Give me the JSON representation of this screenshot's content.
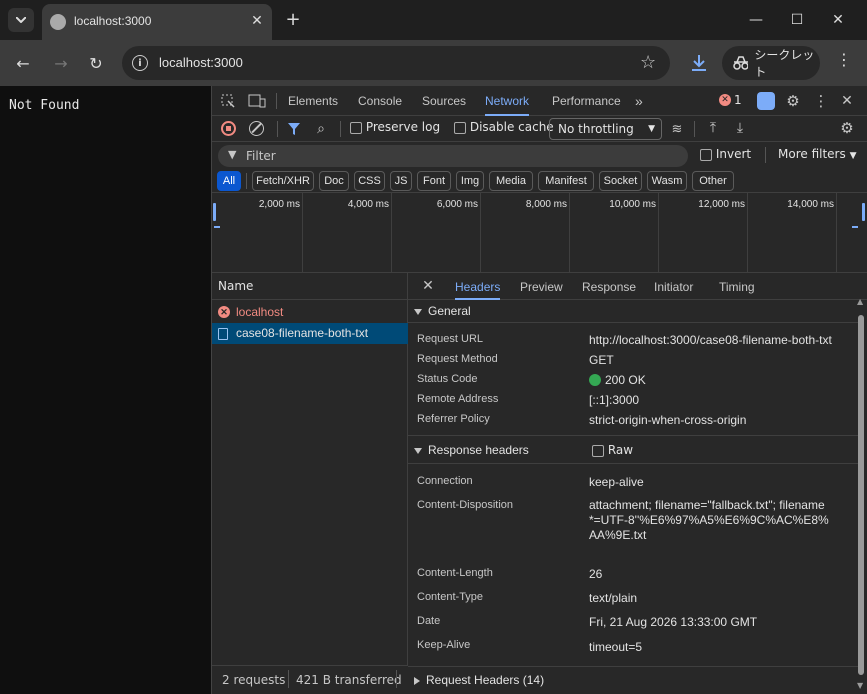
{
  "browser": {
    "tab_title": "localhost:3000",
    "url": "localhost:3000",
    "incognito_label": "シークレット"
  },
  "page": {
    "body_text": "Not Found"
  },
  "devtools": {
    "panels": [
      "Elements",
      "Console",
      "Sources",
      "Network",
      "Performance"
    ],
    "active_panel": "Network",
    "error_count": "1",
    "toolbar": {
      "preserve_log": "Preserve log",
      "disable_cache": "Disable cache",
      "throttling": "No throttling"
    },
    "filter": {
      "placeholder": "Filter",
      "invert": "Invert",
      "more_filters": "More filters"
    },
    "type_filters": [
      "All",
      "Fetch/XHR",
      "Doc",
      "CSS",
      "JS",
      "Font",
      "Img",
      "Media",
      "Manifest",
      "Socket",
      "Wasm",
      "Other"
    ],
    "timeline_ticks": [
      "2,000 ms",
      "4,000 ms",
      "6,000 ms",
      "8,000 ms",
      "10,000 ms",
      "12,000 ms",
      "14,000 ms"
    ],
    "request_list": {
      "column_name": "Name",
      "rows": [
        {
          "name": "localhost",
          "status": "error"
        },
        {
          "name": "case08-filename-both-txt",
          "status": "selected"
        }
      ],
      "summary_requests": "2 requests",
      "summary_transferred": "421 B transferred"
    },
    "details": {
      "tabs": [
        "Headers",
        "Preview",
        "Response",
        "Initiator",
        "Timing"
      ],
      "active_tab": "Headers",
      "general": {
        "title": "General",
        "rows": [
          {
            "key": "Request URL",
            "value": "http://localhost:3000/case08-filename-both-txt"
          },
          {
            "key": "Request Method",
            "value": "GET"
          },
          {
            "key": "Status Code",
            "value": "200 OK"
          },
          {
            "key": "Remote Address",
            "value": "[::1]:3000"
          },
          {
            "key": "Referrer Policy",
            "value": "strict-origin-when-cross-origin"
          }
        ]
      },
      "response_headers": {
        "title": "Response headers",
        "raw_label": "Raw",
        "rows": [
          {
            "key": "Connection",
            "value": "keep-alive"
          },
          {
            "key": "Content-Disposition",
            "value": "attachment; filename=\"fallback.txt\"; filename*=UTF-8''%E6%97%A5%E6%9C%AC%E8%AA%9E.txt"
          },
          {
            "key": "Content-Length",
            "value": "26"
          },
          {
            "key": "Content-Type",
            "value": "text/plain"
          },
          {
            "key": "Date",
            "value": "Fri, 21 Aug 2026 13:33:00 GMT"
          },
          {
            "key": "Keep-Alive",
            "value": "timeout=5"
          }
        ]
      },
      "request_headers": {
        "title": "Request Headers (14)"
      }
    }
  },
  "colors": {
    "accent": "#7cacf8",
    "status_ok": "#34a853",
    "error": "#f28b82",
    "selected_row": "#004a77"
  }
}
